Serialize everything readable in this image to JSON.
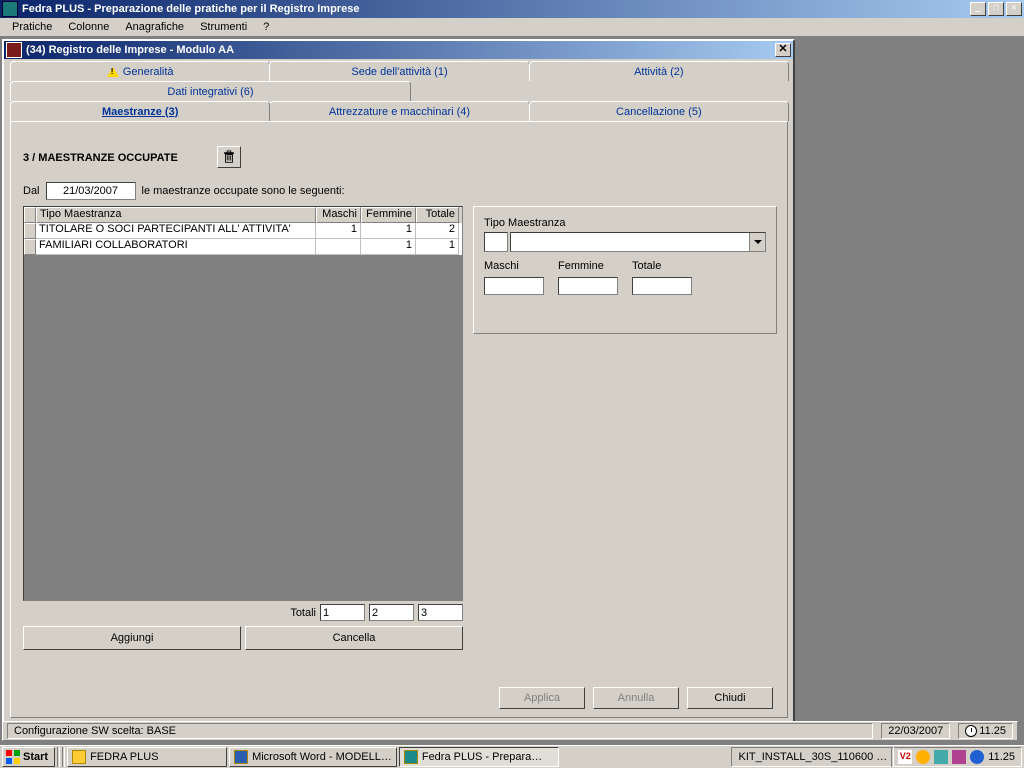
{
  "app": {
    "title": "Fedra PLUS  - Preparazione delle pratiche per il Registro Imprese",
    "menu": [
      "Pratiche",
      "Colonne",
      "Anagrafiche",
      "Strumenti",
      "?"
    ]
  },
  "child": {
    "title": "(34) Registro delle Imprese - Modulo AA"
  },
  "tabs": {
    "row1": [
      "Generalità",
      "Sede dell'attività (1)",
      "Attività (2)"
    ],
    "row2": [
      "Dati integrativi (6)"
    ],
    "row3": [
      "Maestranze (3)",
      "Attrezzature e macchinari (4)",
      "Cancellazione (5)"
    ]
  },
  "section": "3 / MAESTRANZE OCCUPATE",
  "dal": {
    "label": "Dal",
    "value": "21/03/2007",
    "suffix": "le maestranze occupate sono le seguenti:"
  },
  "grid": {
    "headers": [
      "Tipo Maestranza",
      "Maschi",
      "Femmine",
      "Totale"
    ],
    "rows": [
      {
        "tipo": "TITOLARE O SOCI PARTECIPANTI ALL' ATTIVITA'",
        "m": "1",
        "f": "1",
        "t": "2"
      },
      {
        "tipo": "FAMILIARI COLLABORATORI",
        "m": "",
        "f": "1",
        "t": "1"
      }
    ],
    "totals_label": "Totali",
    "totals": {
      "m": "1",
      "f": "2",
      "t": "3"
    }
  },
  "buttons": {
    "add": "Aggiungi",
    "del": "Cancella"
  },
  "detail": {
    "tipo_label": "Tipo Maestranza",
    "maschi": "Maschi",
    "femmine": "Femmine",
    "totale": "Totale"
  },
  "dialog": {
    "apply": "Applica",
    "cancel": "Annulla",
    "close": "Chiudi"
  },
  "statusbar": {
    "config": "Configurazione SW scelta: BASE",
    "date": "22/03/2007",
    "time": "11.25"
  },
  "taskbar": {
    "start": "Start",
    "items": [
      {
        "label": "FEDRA PLUS",
        "active": false,
        "type": "folder"
      },
      {
        "label": "Microsoft Word - MODELL…",
        "active": false,
        "type": "word"
      },
      {
        "label": "Fedra PLUS  - Prepara…",
        "active": true,
        "type": "app"
      }
    ],
    "tray_text": "KIT_INSTALL_30S_110600 …",
    "tray_time": "11.25"
  }
}
